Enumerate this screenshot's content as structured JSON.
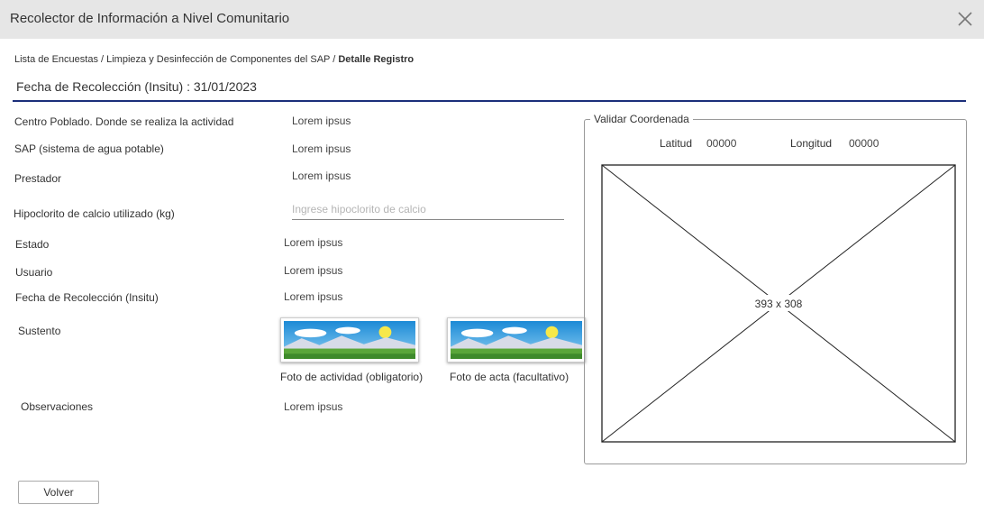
{
  "window": {
    "title": "Recolector de Información a Nivel Comunitario",
    "close_icon": "close-icon"
  },
  "breadcrumb": {
    "items": [
      "Lista de Encuestas",
      "Limpieza y Desinfección de Componentes del SAP"
    ],
    "separator": " / ",
    "current": "Detalle Registro"
  },
  "header": {
    "date_text": "Fecha de Recolección (Insitu) : 31/01/2023"
  },
  "fields": {
    "centro_poblado": {
      "label": "Centro Poblado. Donde se realiza la actividad",
      "value": "Lorem ipsus"
    },
    "sap": {
      "label": "SAP (sistema de agua potable)",
      "value": "Lorem ipsus"
    },
    "prestador": {
      "label": "Prestador",
      "value": "Lorem ipsus"
    },
    "hipoclorito": {
      "label": "Hipoclorito de calcio utilizado (kg)",
      "value": "",
      "placeholder": "Ingrese hipoclorito de calcio"
    },
    "estado": {
      "label": "Estado",
      "value": "Lorem ipsus"
    },
    "usuario": {
      "label": "Usuario",
      "value": "Lorem ipsus"
    },
    "fecha": {
      "label": "Fecha de Recolección (Insitu)",
      "value": "Lorem ipsus"
    },
    "sustento": {
      "label": "Sustento",
      "photos": [
        {
          "caption": "Foto de actividad (obligatorio)",
          "icon": "landscape-image-icon"
        },
        {
          "caption": "Foto de acta (facultativo)",
          "icon": "landscape-image-icon"
        }
      ]
    },
    "observaciones": {
      "label": "Observaciones",
      "value": "Lorem ipsus"
    }
  },
  "coordinates": {
    "legend": "Validar Coordenada",
    "lat_label": "Latitud",
    "lat_value": "00000",
    "lon_label": "Longitud",
    "lon_value": "00000",
    "map_placeholder": "393 x 308"
  },
  "actions": {
    "back_label": "Volver"
  }
}
